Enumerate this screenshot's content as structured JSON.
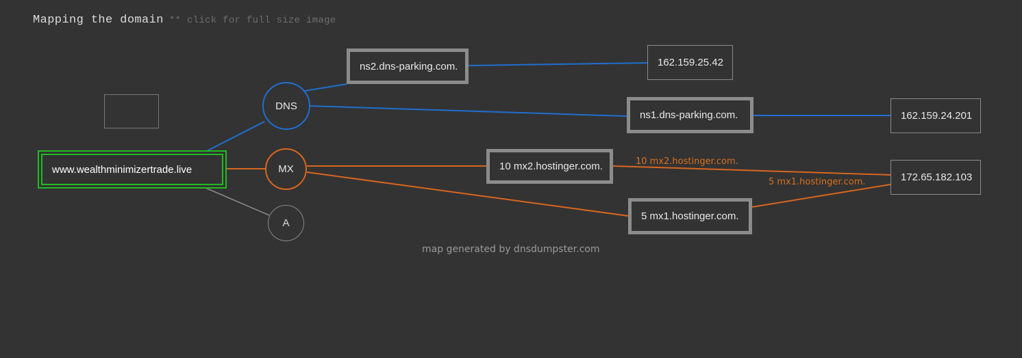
{
  "header": {
    "title": "Mapping the domain",
    "subtitle": "** click for full size image"
  },
  "footer": {
    "credit": "map generated by dnsdumpster.com"
  },
  "colors": {
    "background": "#333333",
    "dns_blue": "#1f6fd0",
    "mx_orange": "#d9661f",
    "a_gray": "#8a8a8a",
    "domain_green": "#22bb22",
    "box_border": "#8c8c8c",
    "text": "#e8e8e8"
  },
  "graph": {
    "root": {
      "label": "www.wealthminimizertrade.live",
      "type": "domain"
    },
    "placeholder_box": {
      "label": ""
    },
    "record_types": [
      {
        "id": "dns",
        "label": "DNS",
        "color": "#1f6fd0"
      },
      {
        "id": "mx",
        "label": "MX",
        "color": "#d9661f"
      },
      {
        "id": "a",
        "label": "A",
        "color": "#8a8a8a"
      }
    ],
    "nameservers": [
      {
        "label": "ns2.dns-parking.com.",
        "ip": "162.159.25.42"
      },
      {
        "label": "ns1.dns-parking.com.",
        "ip": "162.159.24.201"
      }
    ],
    "mailservers": [
      {
        "label": "10 mx2.hostinger.com.",
        "priority": "10",
        "host": "mx2.hostinger.com.",
        "ip": "172.65.182.103"
      },
      {
        "label": "5 mx1.hostinger.com.",
        "priority": "5",
        "host": "mx1.hostinger.com.",
        "ip": "172.65.182.103"
      }
    ],
    "edge_labels": [
      {
        "text": "10 mx2.hostinger.com."
      },
      {
        "text": "5 mx1.hostinger.com."
      }
    ],
    "ip_nodes": [
      {
        "label": "162.159.25.42"
      },
      {
        "label": "162.159.24.201"
      },
      {
        "label": "172.65.182.103"
      }
    ]
  }
}
